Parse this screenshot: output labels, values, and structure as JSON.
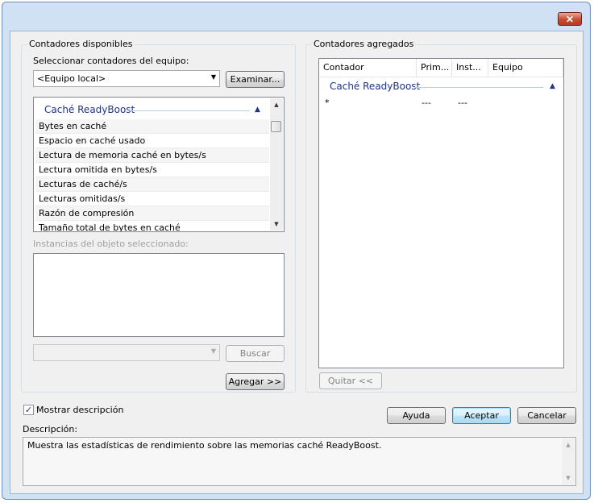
{
  "window": {
    "close_glyph": "✕",
    "close_icon": "close-icon",
    "colors": {
      "frame": "#cfe1f2",
      "client": "#f0f0f0",
      "group_header": "#1e3287",
      "close": "#c74a32"
    }
  },
  "available": {
    "group_label": "Contadores disponibles",
    "select_label": "Seleccionar contadores del equipo:",
    "computer_value": "<Equipo local>",
    "browse_button": "Examinar...",
    "counter_group": "Caché ReadyBoost",
    "counters": [
      "Bytes en caché",
      "Espacio en caché usado",
      "Lectura de memoria caché en bytes/s",
      "Lectura omitida en bytes/s",
      "Lecturas de caché/s",
      "Lecturas omitidas/s",
      "Razón de compresión",
      "Tamaño total de bytes en caché"
    ],
    "instances_label": "Instancias del objeto seleccionado:",
    "search_button": "Buscar",
    "add_button": "Agregar >>"
  },
  "added": {
    "group_label": "Contadores agregados",
    "columns": [
      "Contador",
      "Prim...",
      "Inst...",
      "Equipo"
    ],
    "counter_group": "Caché ReadyBoost",
    "rows": [
      {
        "counter": "*",
        "parent": "---",
        "instance": "---",
        "computer": ""
      }
    ],
    "remove_button": "Quitar <<"
  },
  "bottom": {
    "show_description_label": "Mostrar descripción",
    "show_description_checked": true,
    "check_glyph": "✓",
    "help_button": "Ayuda",
    "ok_button": "Aceptar",
    "cancel_button": "Cancelar",
    "description_label": "Descripción:",
    "description_text": "Muestra las estadísticas de rendimiento sobre las memorias caché ReadyBoost."
  },
  "glyphs": {
    "dropdown": "▼",
    "collapse": "▲",
    "scroll_up": "▲",
    "scroll_down": "▼"
  }
}
